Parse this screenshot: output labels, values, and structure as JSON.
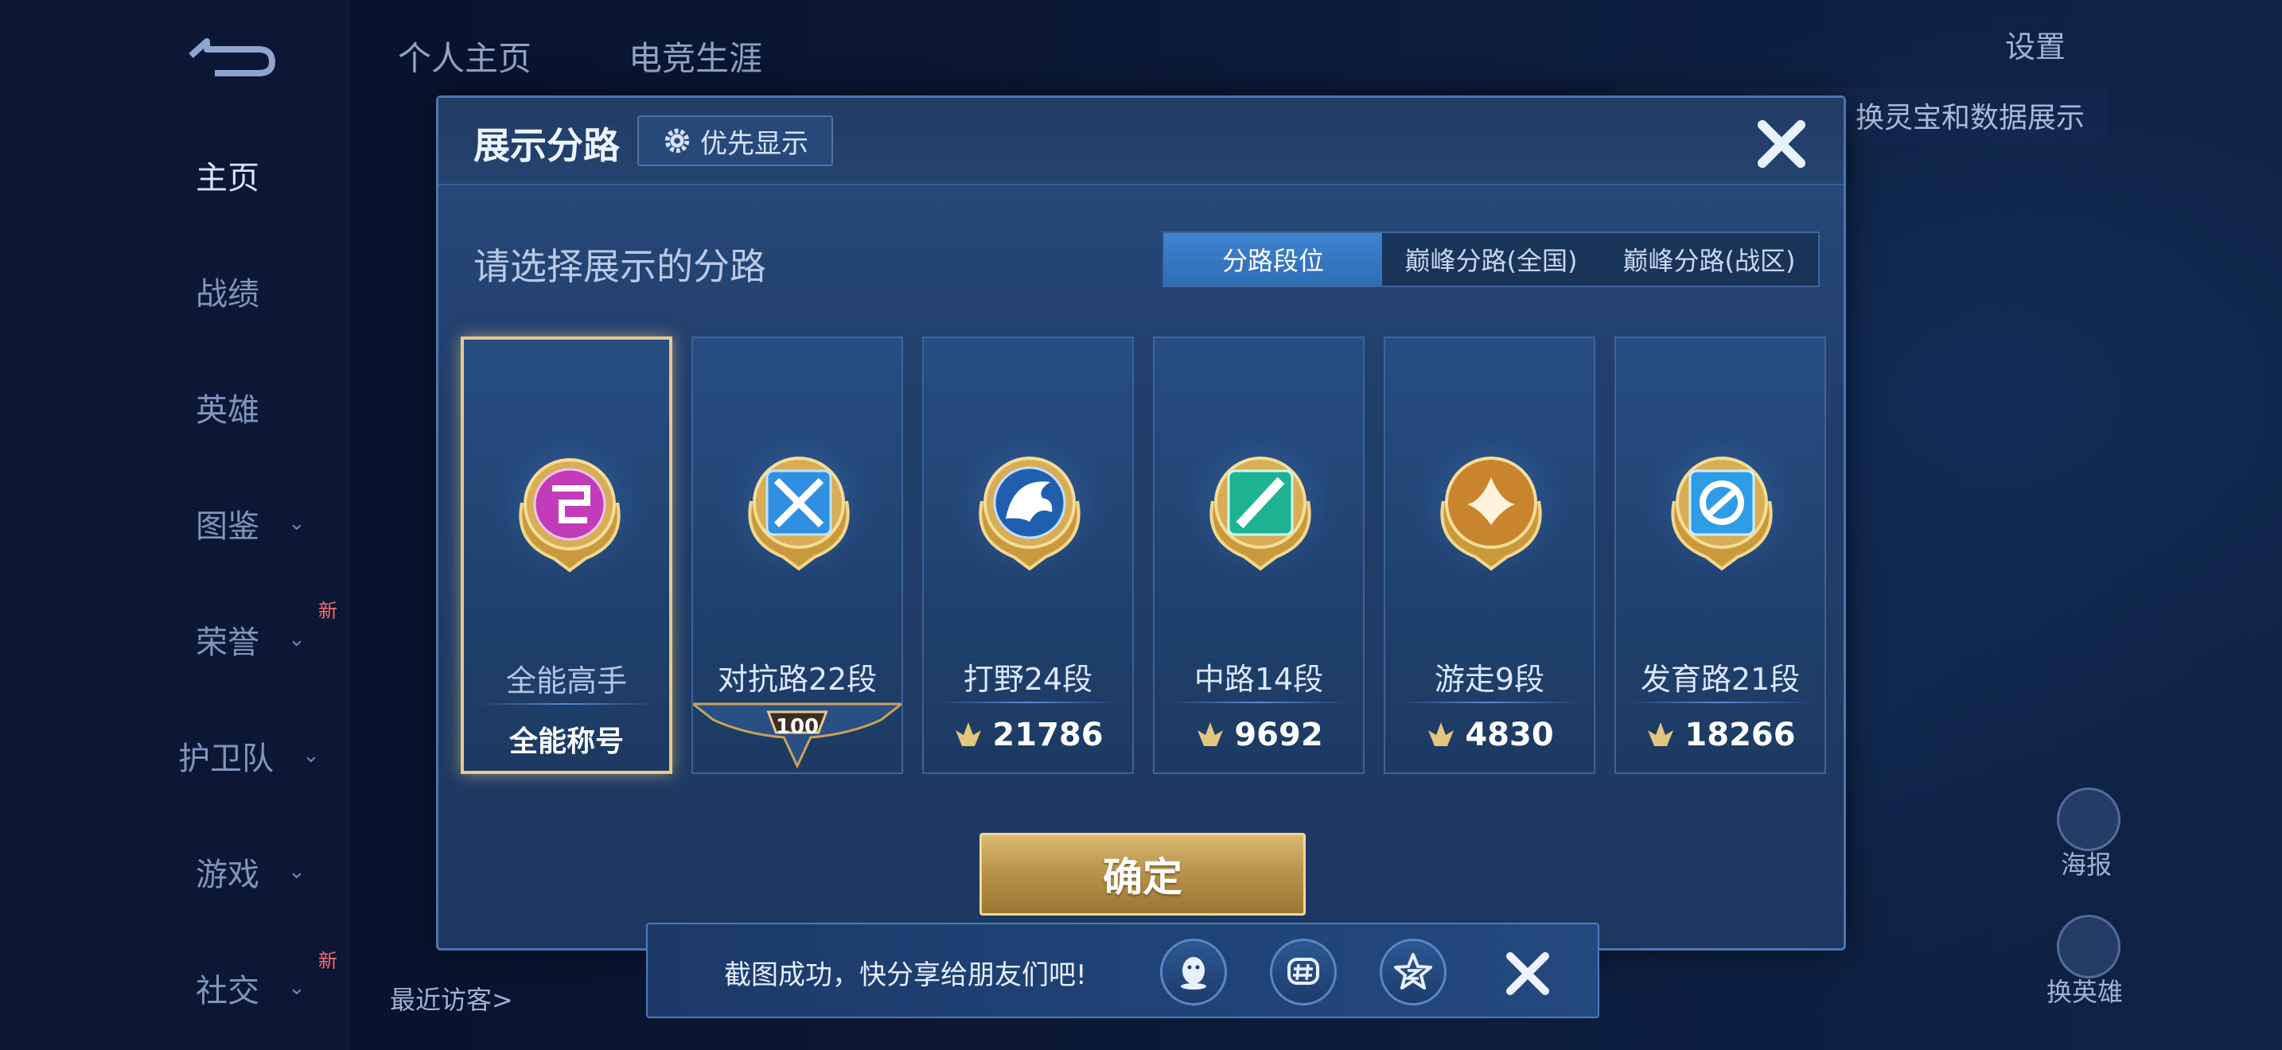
{
  "left_nav": {
    "items": [
      {
        "label": "主页",
        "active": true,
        "chevron": false
      },
      {
        "label": "战绩",
        "active": false,
        "chevron": false
      },
      {
        "label": "英雄",
        "active": false,
        "chevron": false
      },
      {
        "label": "图鉴",
        "active": false,
        "chevron": true
      },
      {
        "label": "荣誉",
        "active": false,
        "chevron": true,
        "badge": "新"
      },
      {
        "label": "护卫队",
        "active": false,
        "chevron": true
      },
      {
        "label": "游戏",
        "active": false,
        "chevron": true
      },
      {
        "label": "社交",
        "active": false,
        "chevron": true,
        "badge": "新"
      }
    ],
    "recent_visitors": "最近访客>"
  },
  "top_tabs": [
    "个人主页",
    "电竞生涯"
  ],
  "settings_label": "设置",
  "swap_label": "换灵宝和数据展示",
  "right_labels": {
    "poster": "海报",
    "swap_hero": "换英雄"
  },
  "modal": {
    "title": "展示分路",
    "priority_label": "优先显示",
    "subtitle": "请选择展示的分路",
    "segments": [
      "分路段位",
      "巅峰分路(全国)",
      "巅峰分路(战区)"
    ],
    "active_segment": 0,
    "cards": [
      {
        "name": "全能高手",
        "footer": "全能称号",
        "footer_type": "title",
        "color": "#c23bb8",
        "selected": true
      },
      {
        "name": "对抗路22段",
        "footer": "100",
        "footer_type": "level",
        "color": "#2f8fe0",
        "selected": false
      },
      {
        "name": "打野24段",
        "footer": "21786",
        "footer_type": "score",
        "color": "#2b6fc9",
        "selected": false
      },
      {
        "name": "中路14段",
        "footer": "9692",
        "footer_type": "score",
        "color": "#1eb392",
        "selected": false
      },
      {
        "name": "游走9段",
        "footer": "4830",
        "footer_type": "score",
        "color": "#c8852e",
        "selected": false
      },
      {
        "name": "发育路21段",
        "footer": "18266",
        "footer_type": "score",
        "color": "#2f9ce6",
        "selected": false
      }
    ],
    "confirm_label": "确定"
  },
  "toast": {
    "text": "截图成功，快分享给朋友们吧!",
    "share_icons": [
      "qq-icon",
      "moments-icon",
      "qzone-icon"
    ]
  },
  "colors": {
    "accent_gold": "#e7c98a",
    "segment_active": "#3f83d0"
  }
}
